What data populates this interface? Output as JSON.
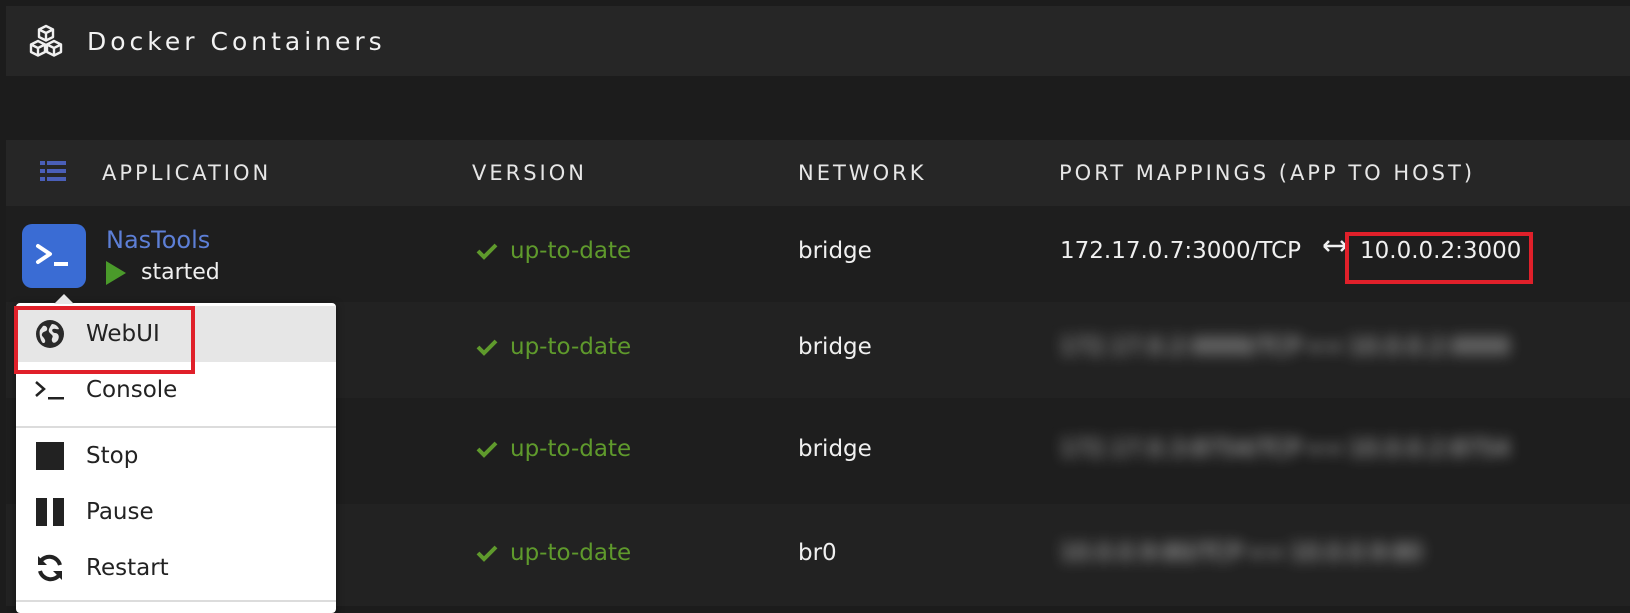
{
  "header": {
    "title": "Docker Containers",
    "icon": "cubes-icon"
  },
  "columns": {
    "application": "APPLICATION",
    "version": "VERSION",
    "network": "NETWORK",
    "port_mappings": "PORT MAPPINGS (APP TO HOST)"
  },
  "rows": [
    {
      "name": "NasTools",
      "state": "started",
      "version": "up-to-date",
      "network": "bridge",
      "port_app": "172.17.0.7:3000/TCP",
      "port_host": "10.0.0.2:3000"
    },
    {
      "version": "up-to-date",
      "network": "bridge",
      "port_blurred": "172.17.0.2:8888/TCP ⟷ 10.0.0.2:8888"
    },
    {
      "version": "up-to-date",
      "network": "bridge",
      "port_blurred": "172.17.0.3:8754/TCP ⟷ 10.0.0.2:8754"
    },
    {
      "version": "up-to-date",
      "network": "br0",
      "port_blurred": "10.0.0.9:80/TCP ⟷ 10.0.0.9:80"
    }
  ],
  "menu": {
    "items": [
      {
        "label": "WebUI",
        "icon": "globe-icon"
      },
      {
        "label": "Console",
        "icon": "terminal-icon"
      },
      {
        "label": "Stop",
        "icon": "stop-icon"
      },
      {
        "label": "Pause",
        "icon": "pause-icon"
      },
      {
        "label": "Restart",
        "icon": "refresh-icon"
      }
    ]
  },
  "colors": {
    "accent": "#3a6cd4",
    "version_ok": "#5f9a2c",
    "highlight": "#e0202a"
  }
}
